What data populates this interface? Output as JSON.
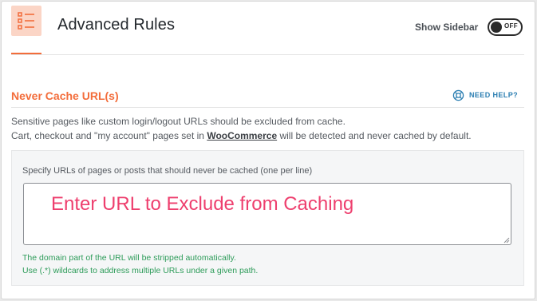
{
  "header": {
    "title": "Advanced Rules",
    "sidebar_label": "Show Sidebar",
    "toggle_state": "OFF",
    "logo_icon": "list-settings-icon"
  },
  "section": {
    "title": "Never Cache URL(s)",
    "help_label": "NEED HELP?",
    "help_icon": "lifebuoy-icon"
  },
  "description": {
    "line1": "Sensitive pages like custom login/logout URLs should be excluded from cache.",
    "line2_before": "Cart, checkout and \"my account\" pages set in ",
    "line2_link": "WooCommerce",
    "line2_after": " will be detected and never cached by default."
  },
  "field": {
    "label": "Specify URLs of pages or posts that should never be cached (one per line)",
    "placeholder": "Enter URL to Exclude from Caching",
    "value": "",
    "hint1": "The domain part of the URL will be stripped automatically.",
    "hint2": "Use (.*) wildcards to address multiple URLs under a given path."
  },
  "colors": {
    "accent": "#f36d3b",
    "link": "#2a7db1",
    "hint": "#2e9c5a",
    "placeholder": "#ee3f6e"
  }
}
